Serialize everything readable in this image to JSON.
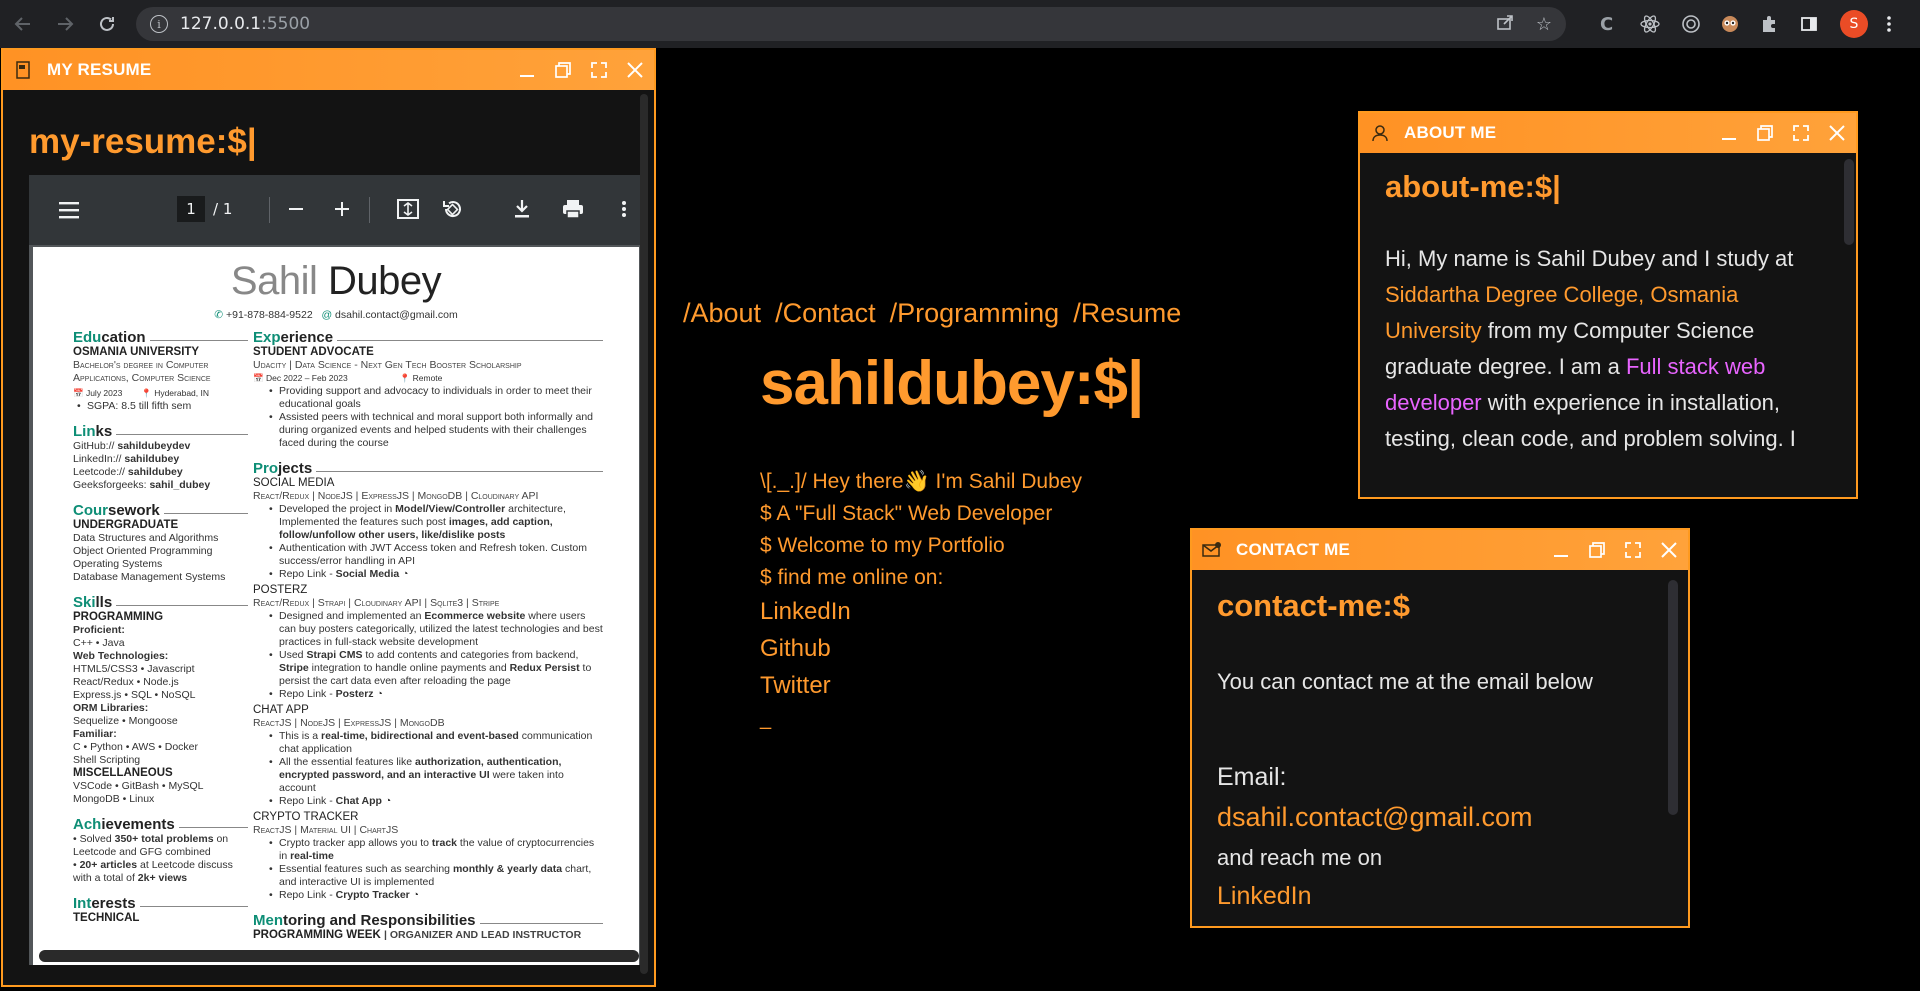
{
  "browser": {
    "url_host": "127.0.0.1",
    "url_port": ":5500",
    "avatar_letter": "S"
  },
  "resume_window": {
    "title": "MY RESUME",
    "prompt": "my-resume:$|",
    "pdf_toolbar": {
      "page_current": "1",
      "page_total": "/ 1"
    },
    "resume": {
      "first_name": "Sahil",
      "last_name": "Dubey",
      "phone": "+91-878-884-9522",
      "email": "dsahil.contact@gmail.com",
      "left": {
        "education": {
          "acc": "Edu",
          "rest": "cation",
          "school": "OSMANIA UNIVERSITY",
          "degree": "Bachelor's degree in Computer Applications, Computer Science",
          "date": "July 2023",
          "loc": "Hyderabad, IN",
          "gpa": "SGPA: 8.5 till fifth sem"
        },
        "links": {
          "acc": "Lin",
          "rest": "ks",
          "items": [
            {
              "k": "GitHub://",
              "v": "sahildubeydev"
            },
            {
              "k": "LinkedIn://",
              "v": "sahildubey"
            },
            {
              "k": "Leetcode://",
              "v": "sahildubey"
            },
            {
              "k": "Geeksforgeeks:",
              "v": "sahil_dubey"
            }
          ]
        },
        "coursework": {
          "acc": "Cour",
          "rest": "sework",
          "sub": "UNDERGRADUATE",
          "items": [
            "Data Structures and Algorithms",
            "Object Oriented Programming",
            "Operating Systems",
            "Database Management Systems"
          ]
        },
        "skills": {
          "acc": "Ski",
          "rest": "lls",
          "sub": "PROGRAMMING",
          "lines": [
            {
              "b": "Proficient:"
            },
            {
              "t": "C++ • Java"
            },
            {
              "b": "Web Technologies:"
            },
            {
              "t": "HTML5/CSS3 • Javascript"
            },
            {
              "t": "React/Redux • Node.js"
            },
            {
              "t": "Express.js • SQL • NoSQL"
            },
            {
              "b": "ORM Libraries:"
            },
            {
              "t": "Sequelize • Mongoose"
            },
            {
              "b": "Familiar:"
            },
            {
              "t": "C • Python • AWS • Docker"
            },
            {
              "t": "Shell Scripting"
            }
          ],
          "sub2": "MISCELLANEOUS",
          "misc": [
            "VSCode • GitBash • MySQL",
            "MongoDB • Linux"
          ]
        },
        "achievements": {
          "acc": "Ach",
          "rest": "ievements",
          "items": [
            {
              "pre": "• Solved ",
              "b": "350+ total problems",
              "post": " on Leetcode and GFG combined"
            },
            {
              "pre": "• ",
              "b": "20+ articles",
              "post": " at Leetcode discuss with a total of ",
              "b2": "2k+ views"
            }
          ]
        },
        "interests": {
          "acc": "Int",
          "rest": "erests",
          "sub": "TECHNICAL"
        }
      },
      "right": {
        "experience": {
          "acc": "Exp",
          "rest": "erience",
          "role": "STUDENT ADVOCATE",
          "org": "Udacity | Data Science - Next Gen Tech Booster Scholarship",
          "date": "Dec 2022 – Feb 2023",
          "loc": "Remote",
          "bullets": [
            "Providing support and advocacy to individuals in order to meet their educational goals",
            "Assisted peers with technical and moral support both informally and during organized events and helped students with their challenges faced during the course"
          ]
        },
        "projects": {
          "acc": "Pro",
          "rest": "jects",
          "items": [
            {
              "name": "SOCIAL MEDIA",
              "stack": "React/Redux | NodeJS | ExpressJS | MongoDB | Cloudinary API",
              "bullets": [
                {
                  "pre": "Developed the project in ",
                  "b": "Model/View/Controller",
                  "post": " architecture, Implemented the features such post ",
                  "b2": "images, add caption, follow/unfollow other users, like/dislike posts"
                },
                {
                  "pre": "Authentication with JWT Access token and Refresh token. Custom success/error handling in API"
                },
                {
                  "pre": "Repo Link - ",
                  "b": "Social Media"
                }
              ]
            },
            {
              "name": "POSTERZ",
              "stack": "React/Redux | Strapi | Cloudinary API | Sqlite3 | Stripe",
              "bullets": [
                {
                  "pre": "Designed and implemented an ",
                  "b": "Ecommerce website",
                  "post": " where users can buy posters categorically, utilized the latest technologies and best practices in full-stack website development"
                },
                {
                  "pre": "Used ",
                  "b": "Strapi CMS",
                  "post": " to add contents and categories from backend, ",
                  "b2": "Stripe",
                  "post2": " integration to handle online payments and ",
                  "b3": "Redux Persist",
                  "post3": " to persist the cart data even after reloading the page"
                },
                {
                  "pre": "Repo Link - ",
                  "b": "Posterz"
                }
              ]
            },
            {
              "name": "CHAT APP",
              "stack": "ReactJS | NodeJS | ExpressJS | MongoDB",
              "bullets": [
                {
                  "pre": "This is a ",
                  "b": "real-time, bidirectional and event-based",
                  "post": " communication chat application"
                },
                {
                  "pre": "All the essential features like ",
                  "b": "authorization, authentication, encrypted password, and an interactive UI",
                  "post": " were taken into account"
                },
                {
                  "pre": "Repo Link - ",
                  "b": "Chat App"
                }
              ]
            },
            {
              "name": "CRYPTO TRACKER",
              "stack": "ReactJS | Material UI | ChartJS",
              "bullets": [
                {
                  "pre": "Crypto tracker app allows you to ",
                  "b": "track",
                  "post": " the value of cryptocurrencies in ",
                  "b2": "real-time"
                },
                {
                  "pre": "Essential features such as searching ",
                  "b": "monthly & yearly data",
                  "post": " chart, and interactive UI is implemented"
                },
                {
                  "pre": "Repo Link - ",
                  "b": "Crypto Tracker"
                }
              ]
            }
          ]
        },
        "mentoring": {
          "acc": "Men",
          "rest": "toring and Responsibilities",
          "sub": "PROGRAMMING WEEK",
          "org": "| Organizer and Lead Instructor"
        }
      }
    }
  },
  "center": {
    "nav": [
      "/About",
      "/Contact",
      "/Programming",
      "/Resume"
    ],
    "heading": "sahildubey:$|",
    "lines": [
      "\\[._.]/ Hey there👋 I'm Sahil Dubey",
      "$ A \"Full Stack\" Web Developer",
      "$ Welcome to my Portfolio",
      "$ find me online on:"
    ],
    "links": [
      "LinkedIn",
      "Github",
      "Twitter"
    ],
    "cursor": "_"
  },
  "about_window": {
    "title": "ABOUT ME",
    "prompt": "about-me:$|",
    "t1": "Hi, My name is Sahil Dubey and I study at ",
    "college": "Siddartha Degree College, Osmania University",
    "t2": " from my Computer Science graduate degree. I am a ",
    "role": "Full stack web developer",
    "t3": " with experience in installation, testing, clean code, and problem solving. I"
  },
  "contact_window": {
    "title": "CONTACT ME",
    "prompt": "contact-me:$",
    "intro": "You can contact me at the email below",
    "email_label": "Email:",
    "email": "dsahil.contact@gmail.com",
    "reach": "and reach me on",
    "linkedin": "LinkedIn"
  },
  "colors": {
    "accent": "#ff9a2e",
    "pink": "#e864ff",
    "resume_accent": "#0e8e76"
  }
}
